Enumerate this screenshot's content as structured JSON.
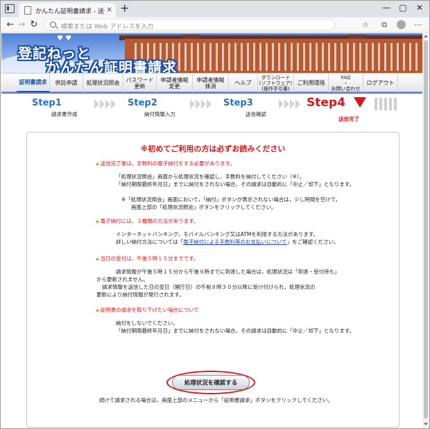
{
  "browser": {
    "tab_title": "かんたん証明書請求 - 送信完了",
    "tab_close": "×",
    "new_tab": "+",
    "window_buttons": [
      "—",
      "▢",
      "✕"
    ],
    "nav": {
      "back": "←",
      "forward": "→",
      "reload": "↻"
    },
    "address_placeholder": "検索または Web アドレスを入力",
    "toolbar_icons": {
      "favorites": "☆",
      "collections": "⧉",
      "more": "⋯"
    }
  },
  "banner": {
    "logo_line1": "登記ねっと",
    "logo_line2": "かんたん証明書請求",
    "logo_bird": "♥ ♥"
  },
  "menu": [
    {
      "label": "証明書請求",
      "active": true
    },
    {
      "label": "供託申請"
    },
    {
      "label": "処理状況照会"
    },
    {
      "label": "パスワード\n更新"
    },
    {
      "label": "申請者情報\n変更"
    },
    {
      "label": "申請者情報\n抹消"
    },
    {
      "label": "ヘルプ"
    },
    {
      "label": "ダウンロード\n(ソフトウェア)\n(操作手引書)"
    },
    {
      "label": "ご利用環境"
    },
    {
      "label": "FAQ\n・\nお問い合わせ"
    },
    {
      "label": "ログアウト"
    }
  ],
  "steps": [
    {
      "label": "Step1",
      "sub": "請求書作成"
    },
    {
      "label": "Step2",
      "sub": "納付情報入力"
    },
    {
      "label": "Step3",
      "sub": "送信確認"
    },
    {
      "label": "Step4",
      "sub": "送信完了",
      "current": true
    }
  ],
  "content": {
    "title": "※初めてご利用の方は必ずお読みください",
    "sections": [
      {
        "head": "送信完了後は，手数料の電子納付をする必要があります。",
        "lines": [
          "「処理状況照会」画面から処理状況を確認し，手数料を納付してください（※）。",
          "「納付期限最終年月日」までに納付をされない場合，その請求は自動的に「中止／却下」となります。",
          "",
          "※「処理状況照会」画面において，「納付」ボタンが表示されない場合は，少し時間を空けて，",
          "画面上部の「処理状況照会」ボタンをクリックしてください。"
        ]
      },
      {
        "head": "電子納付には，３種類の方法があります。",
        "lines": [
          "インターネットバンキング，モバイルバンキング又はATMを利用する方法があります。",
          "詳しい納付方法については「",
          "電子納付による手数料等のお支払いについて",
          "」をご確認ください。"
        ]
      },
      {
        "head": "当日の受付は，午後５時１５分までです。",
        "lines": [
          "請求情報が午後５時１５分から午後９時までに到達した場合は，処理状況は「到達・受付待ち」",
          "から更新されません。",
          "請求情報を送信した日の翌日（開庁日）の午前８時３０分以降に受け付けられ，処理状況の",
          "更新により納付情報が発行されます。"
        ]
      },
      {
        "head": "証明書の請求を取り下げたい場合について",
        "lines": [
          "納付をしないでください。",
          "「納付期限最終年月日」までに納付をされない場合，その請求は自動的に「中止／却下」となります。"
        ]
      }
    ],
    "button_label": "処理状況を確認する",
    "footer": "続けて請求される場合は，画面上部のメニューから「証明書請求」ボタンをクリックしてください。"
  },
  "colors": {
    "accent_red": "#e0121a",
    "step_blue": "#2b6fc7",
    "link_blue": "#1b3fb5",
    "menu_border": "#6a88c9"
  }
}
